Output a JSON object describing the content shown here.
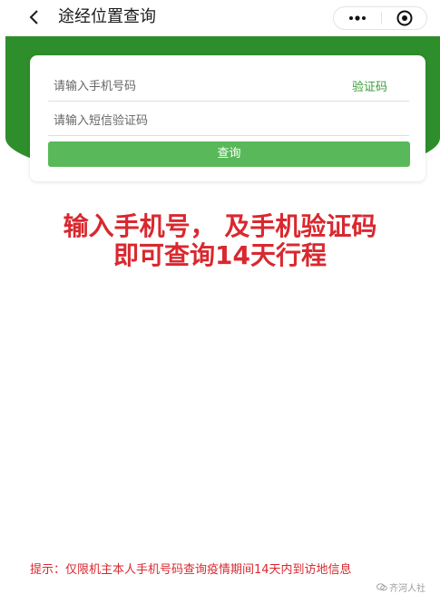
{
  "navbar": {
    "title": "途经位置查询",
    "back_icon": "chevron-left-icon",
    "more_icon": "more-dots-icon",
    "close_icon": "target-close-icon"
  },
  "form": {
    "phone_placeholder": "请输入手机号码",
    "phone_value": "",
    "code_button_label": "验证码",
    "sms_placeholder": "请输入短信验证码",
    "sms_value": "",
    "query_button_label": "查询"
  },
  "overlay": {
    "line1": "输入手机号， 及手机验证码",
    "line2": "即可查询14天行程"
  },
  "hint": {
    "text": "提示：仅限机主本人手机号码查询疫情期间14天内到访地信息"
  },
  "watermark": {
    "text": "齐河人社"
  },
  "colors": {
    "header_green": "#2f8e2c",
    "button_green": "#59b95a",
    "link_green": "#3a9b3a",
    "annotation_red": "#d9282f"
  }
}
